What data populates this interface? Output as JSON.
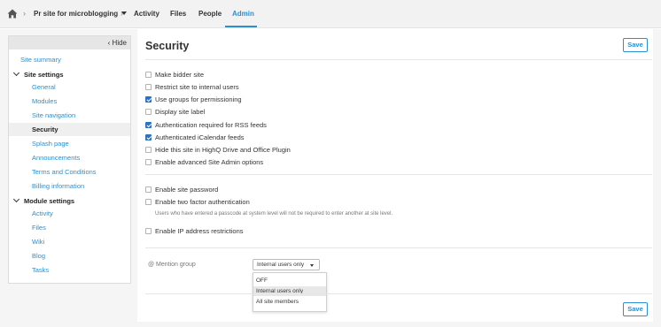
{
  "nav": {
    "site_name": "Pr site for microblogging",
    "tabs": [
      "Activity",
      "Files",
      "People",
      "Admin"
    ],
    "active_tab": "Admin"
  },
  "sidebar": {
    "hide_label": "Hide",
    "site_summary": "Site summary",
    "site_settings_title": "Site settings",
    "site_settings_items": [
      "General",
      "Modules",
      "Site navigation",
      "Security",
      "Splash page",
      "Announcements",
      "Terms and Conditions",
      "Billing information"
    ],
    "active_item": "Security",
    "module_settings_title": "Module settings",
    "module_settings_items": [
      "Activity",
      "Files",
      "Wiki",
      "Blog",
      "Tasks"
    ]
  },
  "page": {
    "title": "Security",
    "save_label": "Save"
  },
  "options_group1": [
    {
      "label": "Make bidder site",
      "checked": false
    },
    {
      "label": "Restrict site to internal users",
      "checked": false
    },
    {
      "label": "Use groups for permissioning",
      "checked": true
    },
    {
      "label": "Display site label",
      "checked": false
    },
    {
      "label": "Authentication required for RSS feeds",
      "checked": true
    },
    {
      "label": "Authenticated iCalendar feeds",
      "checked": true
    },
    {
      "label": "Hide this site in HighQ Drive and Office Plugin",
      "checked": false
    },
    {
      "label": "Enable advanced Site Admin options",
      "checked": false
    }
  ],
  "options_group2": [
    {
      "label": "Enable site password",
      "checked": false
    },
    {
      "label": "Enable two factor authentication",
      "checked": false
    }
  ],
  "two_factor_hint": "Users who have entered a passcode at system level will not be required to enter another at site level.",
  "ip_option": {
    "label": "Enable IP address restrictions",
    "checked": false
  },
  "mention": {
    "label": "@ Mention group",
    "selected": "Internal users only",
    "options": [
      "OFF",
      "Internal users only",
      "All site members"
    ]
  },
  "colors": {
    "accent": "#2b8fd0",
    "checkbox_checked": "#2b72c2"
  }
}
